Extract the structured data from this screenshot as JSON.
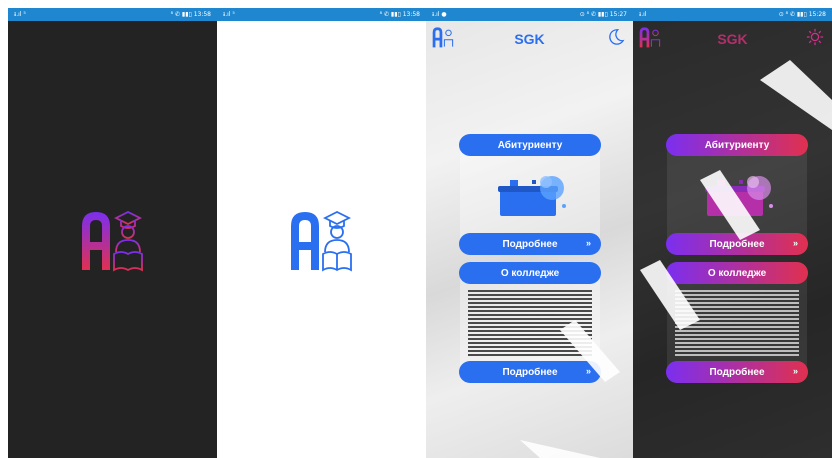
{
  "screens": [
    {
      "id": "splash-dark",
      "status": {
        "left": "ᵻ.ıl ⁵",
        "right": "⁸ ✆ ▮▮▯ 13:58"
      }
    },
    {
      "id": "splash-light",
      "status": {
        "left": "ᵻ.ıl ⁵",
        "right": "⁸ ✆ ▮▮▯ 13:58"
      }
    },
    {
      "id": "home-light",
      "status": {
        "left": "ᵻ.ıl ●",
        "right": "⊙ ⁸ ✆ ▮▮▯ 15:27"
      },
      "title": "SGK",
      "sections": [
        {
          "header": "Абитуриенту",
          "more": "Подробнее"
        },
        {
          "header": "О колледже",
          "more": "Подробнее"
        }
      ]
    },
    {
      "id": "home-dark",
      "status": {
        "left": "ᵻ.ıl",
        "right": "⊙ ⁸ ✆ ▮▮▯ 15:28"
      },
      "title": "SGK",
      "sections": [
        {
          "header": "Абитуриенту",
          "more": "Подробнее"
        },
        {
          "header": "О колледже",
          "more": "Подробнее"
        }
      ]
    }
  ],
  "icons": {
    "mode_light": "moon-icon",
    "mode_dark": "sun-icon",
    "more": "double-chevron-down-icon",
    "logo": "graduate-reading-logo"
  },
  "colors": {
    "status_bar": "#1e87cf",
    "accent_blue": "#2a6ff0",
    "gradient_start": "#7b2ff0",
    "gradient_end": "#e0304f",
    "splash_dark_bg": "#232323"
  }
}
